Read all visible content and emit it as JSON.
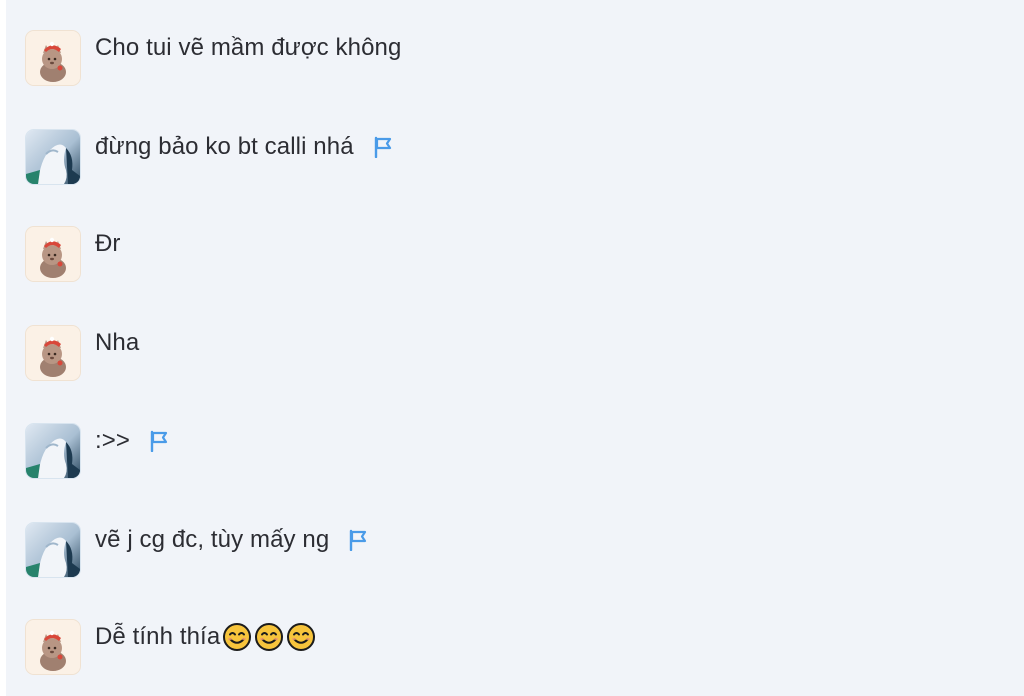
{
  "messages": [
    {
      "author": "cat",
      "text": "Cho tui vẽ mầm được không",
      "flag": false,
      "emoji_count": 0
    },
    {
      "author": "photo",
      "text": "đừng bảo ko bt calli nhá",
      "flag": true,
      "emoji_count": 0
    },
    {
      "author": "cat",
      "text": "Đr",
      "flag": false,
      "emoji_count": 0
    },
    {
      "author": "cat",
      "text": "Nha",
      "flag": false,
      "emoji_count": 0
    },
    {
      "author": "photo",
      "text": ":>>",
      "flag": true,
      "emoji_count": 0
    },
    {
      "author": "photo",
      "text": "vẽ j cg đc, tùy mấy ng",
      "flag": true,
      "emoji_count": 0
    },
    {
      "author": "cat",
      "text": "Dễ tính thía",
      "flag": false,
      "emoji_count": 3,
      "emoji_name": "smiling-face-icon"
    }
  ],
  "icons": {
    "flag": "flag-icon",
    "avatar_cat": "cat-avatar",
    "avatar_photo": "photo-avatar"
  },
  "colors": {
    "background": "#f1f4f9",
    "text": "#2c2d33",
    "flag": "#4a9be8",
    "emoji": "#f7c43c"
  }
}
